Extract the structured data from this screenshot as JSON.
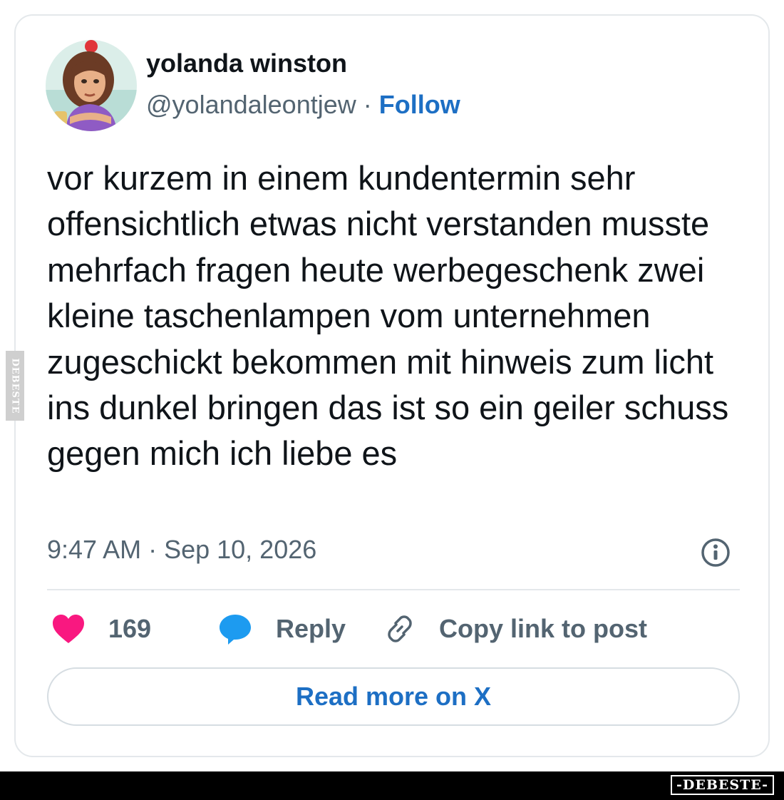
{
  "tweet": {
    "author": {
      "display_name": "yolanda winston",
      "handle": "@yolandaleontjew",
      "separator": " · ",
      "follow_label": "Follow",
      "avatar_icon": "cartoon-woman-avatar"
    },
    "text": "vor kurzem in einem kundentermin sehr offensichtlich etwas nicht verstanden musste mehrfach fragen heute werbegeschenk zwei kleine taschenlampen vom unternehmen zugeschickt bekommen mit hinweis zum licht ins dunkel bringen das ist so ein geiler schuss gegen mich ich liebe es",
    "timestamp": "9:47 AM · Sep 10, 2026",
    "info_icon": "info-icon",
    "actions": {
      "like_count": "169",
      "like_icon": "heart-icon",
      "reply_label": "Reply",
      "reply_icon": "speech-bubble-icon",
      "copy_link_label": "Copy link to post",
      "copy_link_icon": "link-icon"
    },
    "read_more_label": "Read more on X"
  },
  "watermark": {
    "side_text": "DEBESTE",
    "bottom_text": "-DEBESTE-"
  },
  "colors": {
    "like": "#f91880",
    "reply": "#1d9bf0",
    "link_blue": "#1d6fc4",
    "text_primary": "#0f1419",
    "text_secondary": "#536471",
    "border": "#e4e8eb"
  }
}
